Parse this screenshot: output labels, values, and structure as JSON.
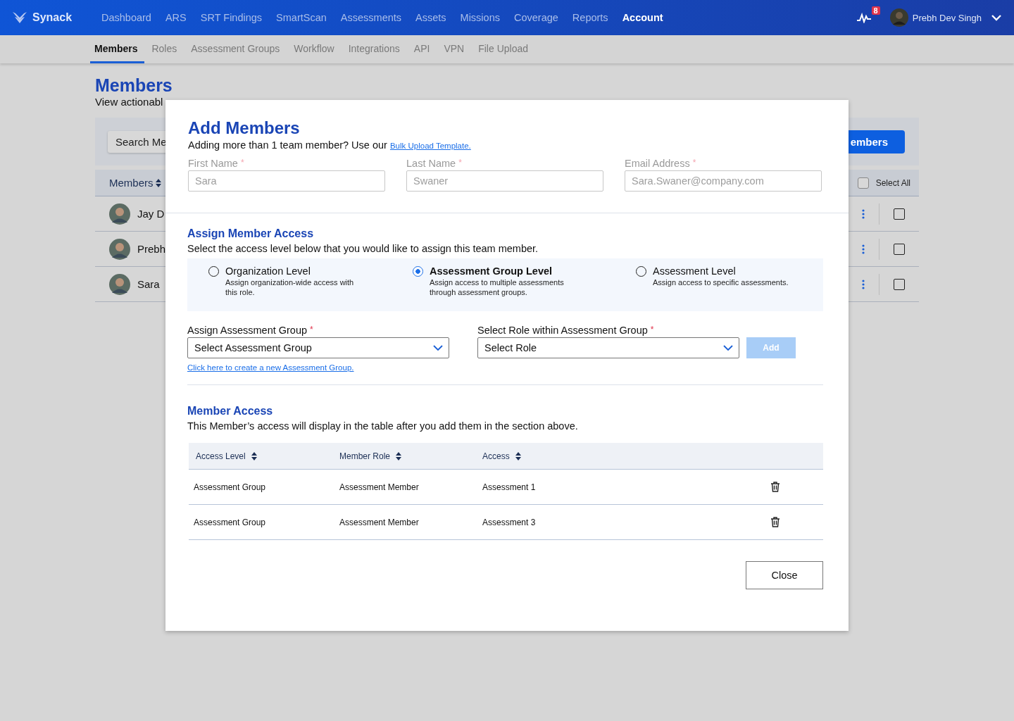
{
  "nav": {
    "brand": "Synack",
    "items": [
      {
        "label": "Dashboard",
        "selected": false
      },
      {
        "label": "ARS",
        "selected": false
      },
      {
        "label": "SRT Findings",
        "selected": false
      },
      {
        "label": "SmartScan",
        "selected": false
      },
      {
        "label": "Assessments",
        "selected": false
      },
      {
        "label": "Assets",
        "selected": false
      },
      {
        "label": "Missions",
        "selected": false
      },
      {
        "label": "Coverage",
        "selected": false
      },
      {
        "label": "Reports",
        "selected": false
      },
      {
        "label": "Account",
        "selected": true
      }
    ],
    "notification_count": "8",
    "user": "Prebh Dev Singh"
  },
  "subnav": [
    {
      "label": "Members",
      "selected": true
    },
    {
      "label": "Roles",
      "selected": false
    },
    {
      "label": "Assessment Groups",
      "selected": false
    },
    {
      "label": "Workflow",
      "selected": false
    },
    {
      "label": "Integrations",
      "selected": false
    },
    {
      "label": "API",
      "selected": false
    },
    {
      "label": "VPN",
      "selected": false
    },
    {
      "label": "File Upload",
      "selected": false
    }
  ],
  "page": {
    "title": "Members",
    "subtitle": "View actionabl",
    "search_placeholder": "Search Me",
    "add_button": "embers",
    "column": "Members",
    "select_all": "Select All",
    "select_all_checked": false,
    "rows": [
      {
        "name": "Jay D",
        "checked": false
      },
      {
        "name": "Prebh",
        "checked": false
      },
      {
        "name": "Sara",
        "checked": false
      }
    ]
  },
  "modal": {
    "title": "Add Members",
    "intro": "Adding more than 1 team member? Use our",
    "intro_link": "Bulk Upload Template.",
    "fields": [
      {
        "label": "First Name",
        "mark": "*",
        "placeholder": "Sara"
      },
      {
        "label": "Last Name",
        "mark": "*",
        "placeholder": "Swaner"
      },
      {
        "label": "Email Address",
        "mark": "*",
        "placeholder": "Sara.Swaner@company.com"
      }
    ],
    "access_title": "Assign Member Access",
    "access_desc": "Select the access level below that you would like to assign this team member.",
    "levels": [
      {
        "label": "Organization Level",
        "desc": "Assign organization-wide access with this role.",
        "selected": false
      },
      {
        "label": "Assessment Group Level",
        "desc": "Assign access to multiple assessments through assessment groups.",
        "selected": true
      },
      {
        "label": "Assessment Level",
        "desc": "Assign access to specific assessments.",
        "selected": false
      }
    ],
    "selects": [
      {
        "label": "Assign Assessment Group",
        "mark": "*",
        "value": "Select Assessment Group"
      },
      {
        "label": "Select Role within Assessment Group",
        "mark": "*",
        "value": "Select Role"
      }
    ],
    "add_button": {
      "label": "Add",
      "disabled": true
    },
    "create_link": "Click here to create a new Assessment Group.",
    "member_access_title": "Member Access",
    "member_access_desc": "This Member’s access will display in the table after you add them in the section above.",
    "table": {
      "columns": [
        "Access Level",
        "Member Role",
        "Access"
      ],
      "rows": [
        [
          "Assessment Group",
          "Assessment Member",
          "Assessment 1"
        ],
        [
          "Assessment Group",
          "Assessment Member",
          "Assessment 3"
        ]
      ]
    },
    "close_button": "Close"
  }
}
